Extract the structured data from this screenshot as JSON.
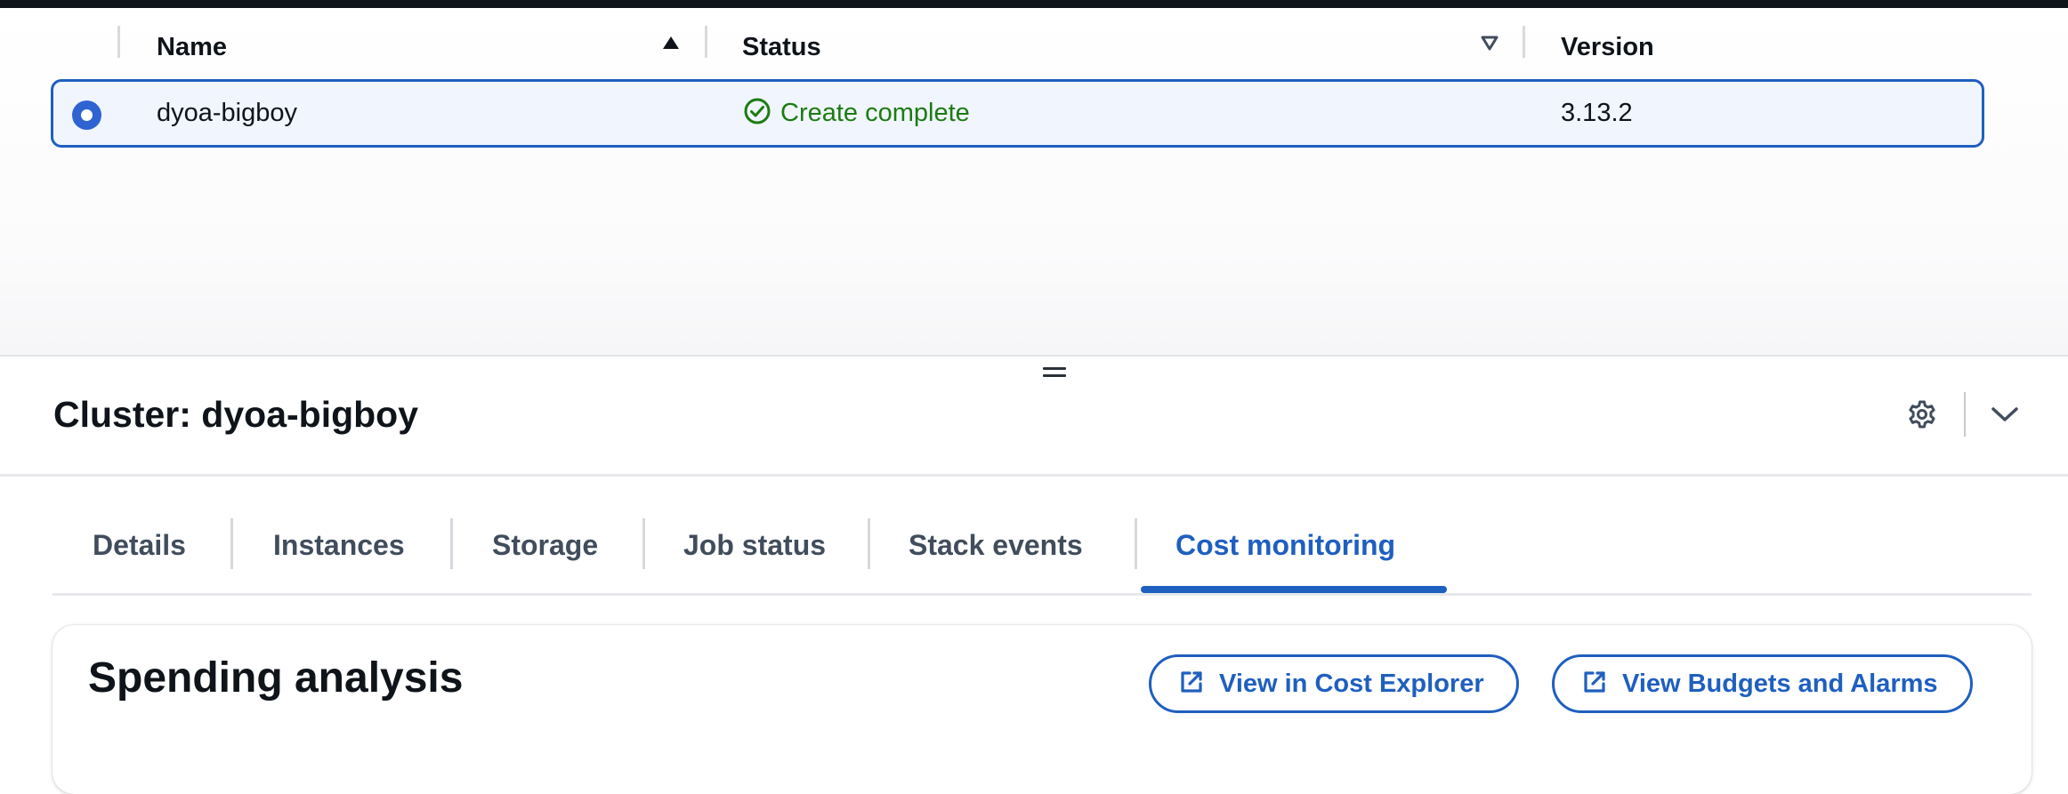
{
  "table": {
    "columns": [
      {
        "label": "Name",
        "sort": "ascending"
      },
      {
        "label": "Status",
        "sort": "filter"
      },
      {
        "label": "Version"
      }
    ],
    "rows": [
      {
        "name": "dyoa-bigboy",
        "status": "Create complete",
        "version": "3.13.2",
        "selected": true
      }
    ]
  },
  "panel": {
    "title": "Cluster: dyoa-bigboy",
    "tabs": [
      {
        "label": "Details"
      },
      {
        "label": "Instances"
      },
      {
        "label": "Storage"
      },
      {
        "label": "Job status"
      },
      {
        "label": "Stack events"
      },
      {
        "label": "Cost monitoring",
        "active": true
      }
    ]
  },
  "spending": {
    "title": "Spending analysis",
    "buttons": {
      "cost_explorer": "View in Cost Explorer",
      "budgets": "View Budgets and Alarms"
    }
  },
  "icons": {
    "sort_asc": "caret-up-icon",
    "sort_filter": "caret-down-outline-icon",
    "status": "check-circle-icon",
    "settings": "gear-icon",
    "collapse": "chevron-down-icon",
    "external": "external-link-icon",
    "resize": "drag-handle-icon"
  },
  "colors": {
    "accent": "#1f5fbf",
    "success": "#1d7b12",
    "selected_row_bg": "#f0f5fe",
    "text": "#0f141a"
  }
}
